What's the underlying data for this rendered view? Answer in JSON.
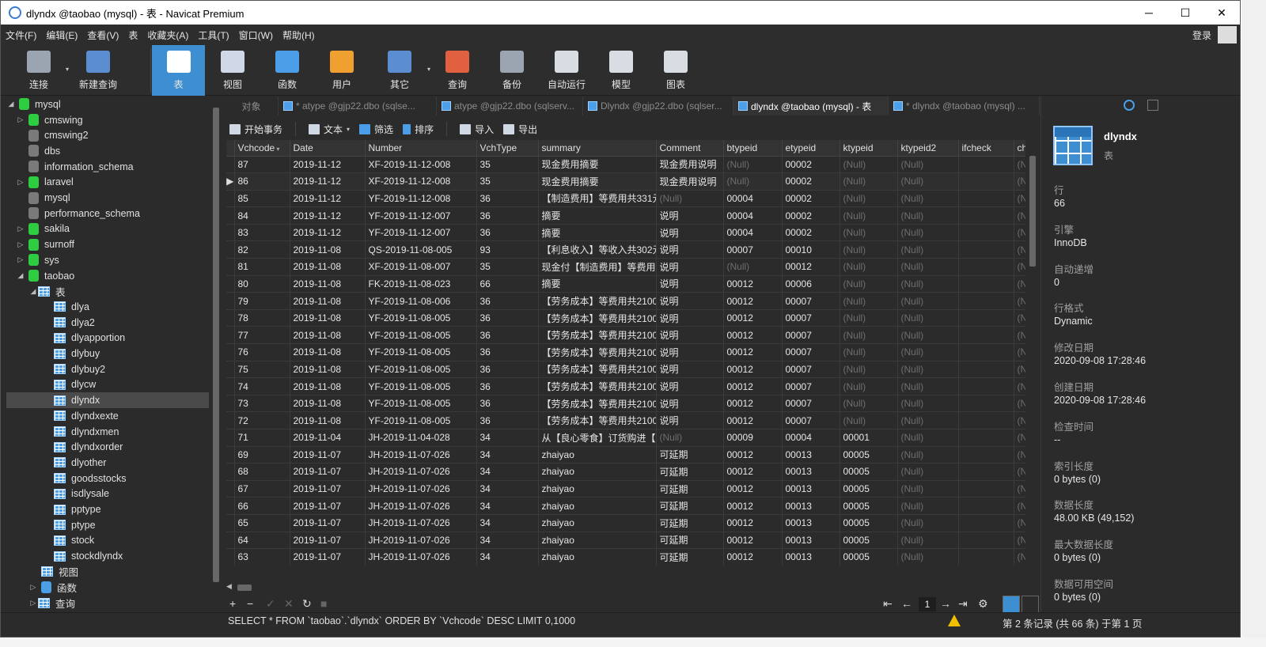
{
  "window": {
    "title": "dlyndx @taobao (mysql) - 表 - Navicat Premium",
    "controls": [
      "─",
      "☐",
      "✕"
    ]
  },
  "menubar": {
    "items": [
      "文件(F)",
      "编辑(E)",
      "查看(V)",
      "表",
      "收藏夹(A)",
      "工具(T)",
      "窗口(W)",
      "帮助(H)"
    ],
    "login": "登录"
  },
  "toolbar": {
    "buttons": [
      {
        "label": "连接",
        "icon": "connection-plug-icon",
        "color": "#9aa5b1"
      },
      {
        "label": "新建查询",
        "icon": "new-query-icon",
        "color": "#5a8ed0"
      },
      {
        "label": "表",
        "icon": "table-icon",
        "color": "#ffffff"
      },
      {
        "label": "视图",
        "icon": "view-icon",
        "color": "#d0d8e8"
      },
      {
        "label": "函数",
        "icon": "function-icon",
        "color": "#4a9fe8"
      },
      {
        "label": "用户",
        "icon": "user-icon",
        "color": "#f0a030"
      },
      {
        "label": "其它",
        "icon": "tools-icon",
        "color": "#5a8ed0"
      },
      {
        "label": "查询",
        "icon": "query-icon",
        "color": "#e06040"
      },
      {
        "label": "备份",
        "icon": "backup-icon",
        "color": "#9aa5b1"
      },
      {
        "label": "自动运行",
        "icon": "autorun-icon",
        "color": "#d8dde3"
      },
      {
        "label": "模型",
        "icon": "model-icon",
        "color": "#d8dde3"
      },
      {
        "label": "图表",
        "icon": "chart-icon",
        "color": "#d8dde3"
      }
    ]
  },
  "tree": {
    "connection": "mysql",
    "databases": [
      {
        "name": "cmswing",
        "open": true
      },
      {
        "name": "cmswing2",
        "open": false
      },
      {
        "name": "dbs",
        "open": false
      },
      {
        "name": "information_schema",
        "open": false
      },
      {
        "name": "laravel",
        "open": true
      },
      {
        "name": "mysql",
        "open": false
      },
      {
        "name": "performance_schema",
        "open": false
      },
      {
        "name": "sakila",
        "open": true
      },
      {
        "name": "surnoff",
        "open": true
      },
      {
        "name": "sys",
        "open": true
      },
      {
        "name": "taobao",
        "open": true
      }
    ],
    "tables_label": "表",
    "tables": [
      "dlya",
      "dlya2",
      "dlyapportion",
      "dlybuy",
      "dlybuy2",
      "dlycw",
      "dlyndx",
      "dlyndxexte",
      "dlyndxmen",
      "dlyndxorder",
      "dlyother",
      "goodsstocks",
      "isdlysale",
      "pptype",
      "ptype",
      "stock",
      "stockdlyndx"
    ],
    "selected_table": "dlyndx",
    "views_label": "视图",
    "functions_label": "函数",
    "queries_label": "查询"
  },
  "tabs": [
    {
      "label": "对象",
      "active": false,
      "icon": false
    },
    {
      "label": "* atype @gjp22.dbo (sqlse...",
      "active": false,
      "icon": true
    },
    {
      "label": "atype @gjp22.dbo (sqlserv...",
      "active": false,
      "icon": true
    },
    {
      "label": "Dlyndx @gjp22.dbo (sqlser...",
      "active": false,
      "icon": true
    },
    {
      "label": "dlyndx @taobao (mysql) - 表",
      "active": true,
      "icon": true
    },
    {
      "label": "* dlyndx @taobao (mysql) ...",
      "active": false,
      "icon": true
    }
  ],
  "subtoolbar": {
    "begin_transaction": "开始事务",
    "text": "文本",
    "filter": "筛选",
    "sort": "排序",
    "import": "导入",
    "export": "导出"
  },
  "grid": {
    "columns": [
      "Vchcode",
      "Date",
      "Number",
      "VchType",
      "summary",
      "Comment",
      "btypeid",
      "etypeid",
      "ktypeid",
      "ktypeid2",
      "ifcheck",
      "ch"
    ],
    "rows": [
      [
        "87",
        "2019-11-12",
        "XF-2019-11-12-008",
        "35",
        "现金费用摘要",
        "现金费用说明",
        "(Null)",
        "00002",
        "(Null)",
        "(Null)",
        "",
        "(N"
      ],
      [
        "86",
        "2019-11-12",
        "XF-2019-11-12-008",
        "35",
        "现金费用摘要",
        "现金费用说明",
        "(Null)",
        "00002",
        "(Null)",
        "(Null)",
        "",
        "(N"
      ],
      [
        "85",
        "2019-11-12",
        "YF-2019-11-12-008",
        "36",
        "【制造费用】等费用共331元",
        "(Null)",
        "00004",
        "00002",
        "(Null)",
        "(Null)",
        "",
        "(N"
      ],
      [
        "84",
        "2019-11-12",
        "YF-2019-11-12-007",
        "36",
        "摘要",
        "说明",
        "00004",
        "00002",
        "(Null)",
        "(Null)",
        "",
        "(N"
      ],
      [
        "83",
        "2019-11-12",
        "YF-2019-11-12-007",
        "36",
        "摘要",
        "说明",
        "00004",
        "00002",
        "(Null)",
        "(Null)",
        "",
        "(N"
      ],
      [
        "82",
        "2019-11-08",
        "QS-2019-11-08-005",
        "93",
        "【利息收入】等收入共302元",
        "说明",
        "00007",
        "00010",
        "(Null)",
        "(Null)",
        "",
        "(N"
      ],
      [
        "81",
        "2019-11-08",
        "XF-2019-11-08-007",
        "35",
        "现金付【制造费用】等费用共",
        "说明",
        "(Null)",
        "00012",
        "(Null)",
        "(Null)",
        "",
        "(N"
      ],
      [
        "80",
        "2019-11-08",
        "FK-2019-11-08-023",
        "66",
        "摘要",
        "说明",
        "00012",
        "00006",
        "(Null)",
        "(Null)",
        "",
        "(N"
      ],
      [
        "79",
        "2019-11-08",
        "YF-2019-11-08-006",
        "36",
        "【劳务成本】等费用共2100",
        "说明",
        "00012",
        "00007",
        "(Null)",
        "(Null)",
        "",
        "(N"
      ],
      [
        "78",
        "2019-11-08",
        "YF-2019-11-08-005",
        "36",
        "【劳务成本】等费用共2100",
        "说明",
        "00012",
        "00007",
        "(Null)",
        "(Null)",
        "",
        "(N"
      ],
      [
        "77",
        "2019-11-08",
        "YF-2019-11-08-005",
        "36",
        "【劳务成本】等费用共2100",
        "说明",
        "00012",
        "00007",
        "(Null)",
        "(Null)",
        "",
        "(N"
      ],
      [
        "76",
        "2019-11-08",
        "YF-2019-11-08-005",
        "36",
        "【劳务成本】等费用共2100",
        "说明",
        "00012",
        "00007",
        "(Null)",
        "(Null)",
        "",
        "(N"
      ],
      [
        "75",
        "2019-11-08",
        "YF-2019-11-08-005",
        "36",
        "【劳务成本】等费用共2100",
        "说明",
        "00012",
        "00007",
        "(Null)",
        "(Null)",
        "",
        "(N"
      ],
      [
        "74",
        "2019-11-08",
        "YF-2019-11-08-005",
        "36",
        "【劳务成本】等费用共2100",
        "说明",
        "00012",
        "00007",
        "(Null)",
        "(Null)",
        "",
        "(N"
      ],
      [
        "73",
        "2019-11-08",
        "YF-2019-11-08-005",
        "36",
        "【劳务成本】等费用共2100",
        "说明",
        "00012",
        "00007",
        "(Null)",
        "(Null)",
        "",
        "(N"
      ],
      [
        "72",
        "2019-11-08",
        "YF-2019-11-08-005",
        "36",
        "【劳务成本】等费用共2100",
        "说明",
        "00012",
        "00007",
        "(Null)",
        "(Null)",
        "",
        "(N"
      ],
      [
        "71",
        "2019-11-04",
        "JH-2019-11-04-028",
        "34",
        "从【良心零食】订货购进【",
        "(Null)",
        "00009",
        "00004",
        "00001",
        "(Null)",
        "",
        "(N"
      ],
      [
        "69",
        "2019-11-07",
        "JH-2019-11-07-026",
        "34",
        "zhaiyao",
        "可延期",
        "00012",
        "00013",
        "00005",
        "(Null)",
        "",
        "(N"
      ],
      [
        "68",
        "2019-11-07",
        "JH-2019-11-07-026",
        "34",
        "zhaiyao",
        "可延期",
        "00012",
        "00013",
        "00005",
        "(Null)",
        "",
        "(N"
      ],
      [
        "67",
        "2019-11-07",
        "JH-2019-11-07-026",
        "34",
        "zhaiyao",
        "可延期",
        "00012",
        "00013",
        "00005",
        "(Null)",
        "",
        "(N"
      ],
      [
        "66",
        "2019-11-07",
        "JH-2019-11-07-026",
        "34",
        "zhaiyao",
        "可延期",
        "00012",
        "00013",
        "00005",
        "(Null)",
        "",
        "(N"
      ],
      [
        "65",
        "2019-11-07",
        "JH-2019-11-07-026",
        "34",
        "zhaiyao",
        "可延期",
        "00012",
        "00013",
        "00005",
        "(Null)",
        "",
        "(N"
      ],
      [
        "64",
        "2019-11-07",
        "JH-2019-11-07-026",
        "34",
        "zhaiyao",
        "可延期",
        "00012",
        "00013",
        "00005",
        "(Null)",
        "",
        "(N"
      ],
      [
        "63",
        "2019-11-07",
        "JH-2019-11-07-026",
        "34",
        "zhaiyao",
        "可延期",
        "00012",
        "00013",
        "00005",
        "(Null)",
        "",
        "(N"
      ]
    ],
    "current_row_index": 1
  },
  "navbar": {
    "page": "1",
    "buttons": [
      "+",
      "−",
      "✓",
      "✕",
      "↻",
      "■",
      "⇤",
      "←",
      "→",
      "⇥",
      "⚙"
    ]
  },
  "statusbar": {
    "sql": "SELECT * FROM `taobao`.`dlyndx` ORDER BY `Vchcode` DESC LIMIT 0,1000",
    "record": "第 2 条记录 (共 66 条) 于第 1 页"
  },
  "info": {
    "name": "dlyndx",
    "type": "表",
    "props": [
      {
        "k": "行",
        "v": "66"
      },
      {
        "k": "引擎",
        "v": "InnoDB"
      },
      {
        "k": "自动递增",
        "v": "0"
      },
      {
        "k": "行格式",
        "v": "Dynamic"
      },
      {
        "k": "修改日期",
        "v": "2020-09-08 17:28:46"
      },
      {
        "k": "创建日期",
        "v": "2020-09-08 17:28:46"
      },
      {
        "k": "检查时间",
        "v": "--"
      },
      {
        "k": "索引长度",
        "v": "0 bytes (0)"
      },
      {
        "k": "数据长度",
        "v": "48.00 KB (49,152)"
      },
      {
        "k": "最大数据长度",
        "v": "0 bytes (0)"
      },
      {
        "k": "数据可用空间",
        "v": "0 bytes (0)"
      }
    ]
  },
  "colors": {
    "accent": "#3d8fd1",
    "db_open": "#2ecc40",
    "db_closed": "#7a7a7a",
    "null_text": "#6e6e6e"
  }
}
